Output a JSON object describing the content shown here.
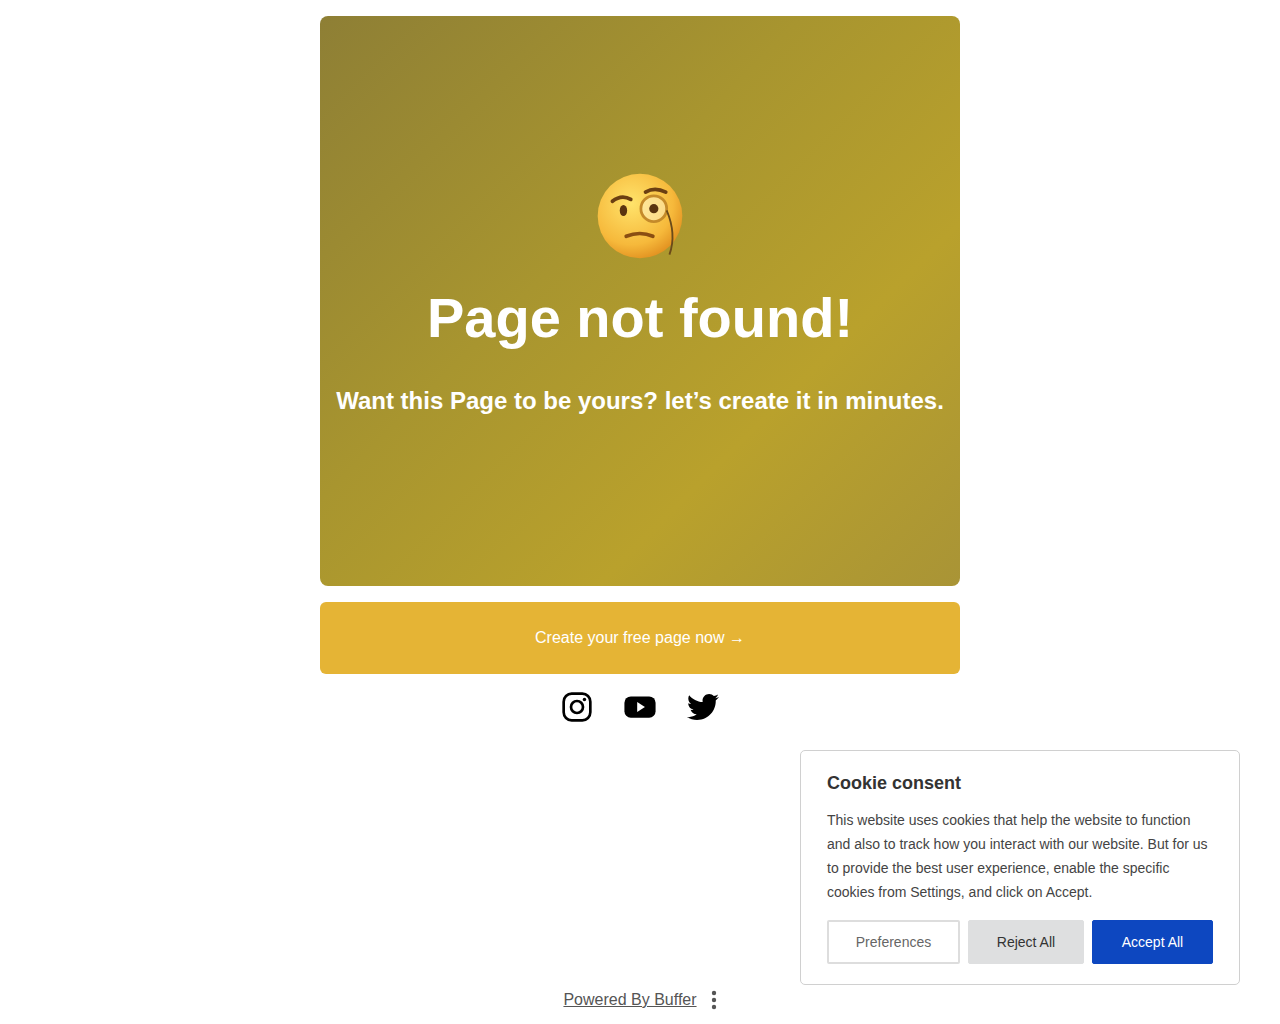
{
  "hero": {
    "title": "Page not found!",
    "subtitle": "Want this Page to be yours? let’s create it in minutes."
  },
  "cta": {
    "label": "Create your free page now →"
  },
  "footer": {
    "text": "Powered By Buffer"
  },
  "cookie": {
    "title": "Cookie consent",
    "text": "This website uses cookies that help the website to function and also to track how you interact with our website. But for us to provide the best user experience, enable the specific cookies from Settings, and click on Accept.",
    "buttons": [
      {
        "label": "Preferences",
        "kind": "outline"
      },
      {
        "label": "Reject All",
        "kind": "secondary"
      },
      {
        "label": "Accept All",
        "kind": "primary"
      }
    ]
  }
}
